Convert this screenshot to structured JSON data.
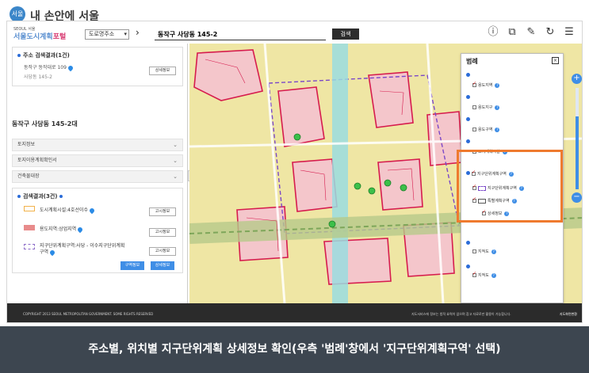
{
  "logo": {
    "circle_text": "서울",
    "title": "내 손안에 서울"
  },
  "header": {
    "brand_small": "SEOUL 서울",
    "brand_main": "서울도시계획",
    "brand_accent": "포털",
    "address_type": "도로명주소",
    "separator": "›",
    "search_value": "동작구 사당동 145-2",
    "search_button": "검색",
    "icons": [
      "info-icon",
      "crop-icon",
      "ruler-icon",
      "refresh-icon",
      "document-icon"
    ]
  },
  "left_panel": {
    "address_result": {
      "title": "주소 검색결과(1건)",
      "road_address": "동작구 동작대로 109",
      "lot_address": "사당동 145-2",
      "detail_button": "상세정보"
    },
    "heading": "동작구 사당동 145-2대",
    "accordion": [
      "토지정보",
      "토지이용계획확인서",
      "건축물대장"
    ],
    "search_results": {
      "title": "검색결과(3건)",
      "items": [
        {
          "label": "도시계획시설:4호선이수",
          "button": "고시정보",
          "swatch": "#f2b24a"
        },
        {
          "label": "용도지역:상업지역",
          "button": "고시정보",
          "swatch": "#e88b8b"
        },
        {
          "label": "지구단위계획구역:사당 - 이수지구단위계획구역",
          "button": "고시정보",
          "swatch": "#8c6bc8"
        }
      ],
      "button_1": "구역정보",
      "button_2": "상세정보"
    }
  },
  "legend": {
    "title": "범례",
    "close": "×",
    "rows": [
      {
        "label": "용도지역",
        "checked": true
      },
      {
        "label": "용도지구",
        "checked": false
      },
      {
        "label": "용도구역",
        "checked": false
      },
      {
        "label": "도시계획시설",
        "checked": false
      },
      {
        "label": "지구단위계획구역",
        "checked": true
      },
      {
        "label": "지구단위계획구역",
        "checked": true
      },
      {
        "label": "특별계획구역",
        "checked": true
      },
      {
        "label": "상세정보",
        "checked": true
      },
      {
        "label": "지적도",
        "checked": false
      },
      {
        "label": "지적도",
        "checked": true
      }
    ]
  },
  "zoom": {
    "plus": "+",
    "minus": "−",
    "level_fraction": 0.72
  },
  "footer": {
    "copyright": "COPYRIGHT 2013 SEOUL METROPOLITAN GOVERNMENT. SOME RIGHTS RESERVED",
    "note": "지도서비스에 정보는 법적 효력이 없으며 참고 자료로만 활용이 가능합니다.",
    "link": "지도화면변환"
  },
  "caption": "주소별, 위치별 지구단위계획 상세정보 확인(우측 '범례'창에서 '지구단위계획구역' 선택)",
  "colors": {
    "accent": "#3f8ee6",
    "highlight": "#ef7a2e",
    "caption_bg": "#3d4650"
  }
}
